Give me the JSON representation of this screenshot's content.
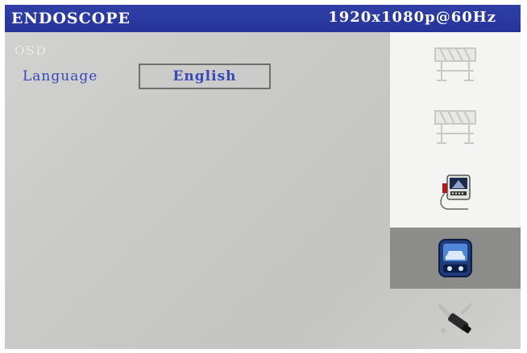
{
  "header": {
    "title": "ENDOSCOPE",
    "resolution": "1920x1080p@60Hz"
  },
  "osd": {
    "section_label": "OSD",
    "language_label": "Language",
    "language_value": "English"
  },
  "sidebar": {
    "items": [
      {
        "icon": "road-barrier-icon",
        "state": "disabled"
      },
      {
        "icon": "road-barrier-icon",
        "state": "disabled"
      },
      {
        "icon": "endoscope-camera-icon",
        "state": "normal"
      },
      {
        "icon": "car-osd-icon",
        "state": "selected"
      },
      {
        "icon": "tools-icon",
        "state": "normal"
      }
    ]
  },
  "colors": {
    "title_bar": "#2b3aa2",
    "label_text": "#3848b8",
    "selected_tile": "#8c8c8a"
  }
}
